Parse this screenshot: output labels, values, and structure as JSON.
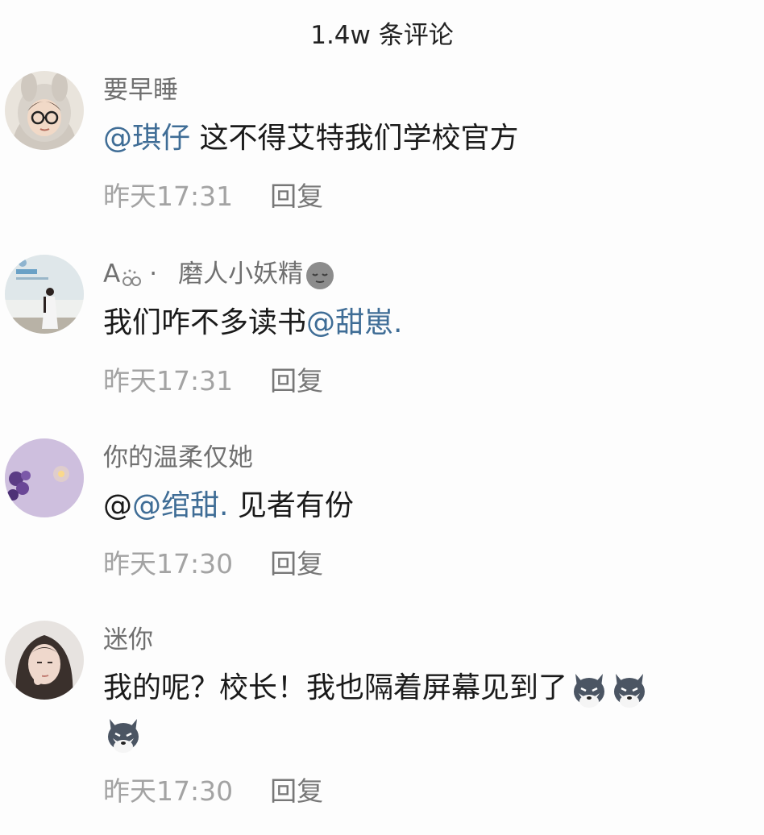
{
  "header": {
    "title": "1.4w 条评论"
  },
  "comments": [
    {
      "username": "要早睡",
      "text_parts": [
        {
          "text": "@琪仔",
          "mention": true
        },
        {
          "text": " 这不得艾特我们学校官方",
          "mention": false
        }
      ],
      "time": "昨天17:31",
      "reply": "回复",
      "avatar_icon": "hooded-person-avatar"
    },
    {
      "username": "A",
      "username_suffix": "·",
      "username_extra": "磨人小妖精",
      "text_parts": [
        {
          "text": "我们咋不多读书",
          "mention": false
        },
        {
          "text": "@甜崽.",
          "mention": true
        }
      ],
      "time": "昨天17:31",
      "reply": "回复",
      "avatar_icon": "standing-girl-avatar"
    },
    {
      "username": "你的温柔仅她",
      "text_parts": [
        {
          "text": "@",
          "mention": false
        },
        {
          "text": "@绾甜.",
          "mention": true
        },
        {
          "text": " 见者有份",
          "mention": false
        }
      ],
      "time": "昨天17:30",
      "reply": "回复",
      "avatar_icon": "purple-flowers-avatar"
    },
    {
      "username": "迷你",
      "text_parts": [
        {
          "text": "我的呢？校长！我也隔着屏幕见到了",
          "mention": false
        }
      ],
      "time": "昨天17:30",
      "reply": "回复",
      "avatar_icon": "girl-portrait-avatar",
      "emoji_icon": "husky-dog-emoji"
    }
  ],
  "colors": {
    "mention": "#3f6d96",
    "username": "#707070",
    "meta": "#a3a3a3",
    "text": "#1a1a1a"
  }
}
